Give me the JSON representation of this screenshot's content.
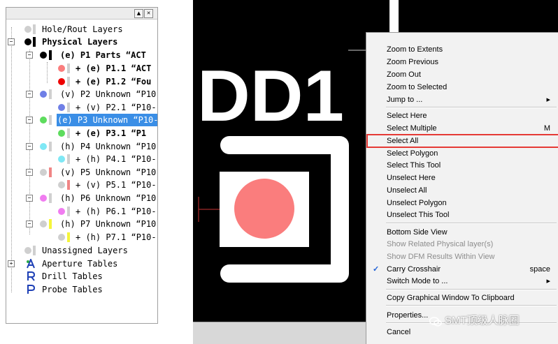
{
  "tree": {
    "items": [
      {
        "label": "Hole/Rout Layers"
      },
      {
        "label": "Physical Layers"
      },
      {
        "label": "(e) P1 Parts “ACT"
      },
      {
        "label": "+ (e) P1.1 “ACT"
      },
      {
        "label": "+ (e) P1.2 “Fou"
      },
      {
        "label": "(v) P2 Unknown “P10-"
      },
      {
        "label": "+ (v) P2.1 “P10-"
      },
      {
        "label": "(e) P3 Unknown “P10-"
      },
      {
        "label": "+ (e) P3.1 “P1"
      },
      {
        "label": "(h) P4 Unknown “P10-"
      },
      {
        "label": "+ (h) P4.1 “P10-"
      },
      {
        "label": "(v) P5 Unknown “P10-"
      },
      {
        "label": "+ (v) P5.1 “P10-"
      },
      {
        "label": "(h) P6 Unknown “P10-"
      },
      {
        "label": "+ (h) P6.1 “P10-"
      },
      {
        "label": "(h) P7 Unknown “P10-"
      },
      {
        "label": "+ (h) P7.1 “P10-"
      },
      {
        "label": "Unassigned Layers"
      },
      {
        "label": "Aperture Tables"
      },
      {
        "label": "Drill Tables"
      },
      {
        "label": "Probe Tables"
      }
    ]
  },
  "canvas": {
    "silkscreen_text": "DD1"
  },
  "menu": {
    "items": [
      {
        "label": "Zoom to Extents",
        "key": ""
      },
      {
        "label": "Zoom Previous",
        "key": ""
      },
      {
        "label": "Zoom Out",
        "key": ""
      },
      {
        "label": "Zoom to Selected",
        "key": ""
      },
      {
        "label": "Jump to ...",
        "key": "▸"
      },
      {
        "label": "Select Here",
        "key": ""
      },
      {
        "label": "Select Multiple",
        "key": "M"
      },
      {
        "label": "Select All",
        "key": ""
      },
      {
        "label": "Select Polygon",
        "key": ""
      },
      {
        "label": "Select This Tool",
        "key": ""
      },
      {
        "label": "Unselect Here",
        "key": ""
      },
      {
        "label": "Unselect All",
        "key": ""
      },
      {
        "label": "Unselect Polygon",
        "key": ""
      },
      {
        "label": "Unselect This Tool",
        "key": ""
      },
      {
        "label": "Bottom Side View",
        "key": ""
      },
      {
        "label": "Show Related Physical layer(s)",
        "key": ""
      },
      {
        "label": "Show DFM Results Within View",
        "key": ""
      },
      {
        "label": "Carry Crosshair",
        "key": "space",
        "check": "✓"
      },
      {
        "label": "Switch Mode to ...",
        "key": "▸"
      },
      {
        "label": "Copy Graphical Window To Clipboard",
        "key": ""
      },
      {
        "label": "Properties...",
        "key": ""
      },
      {
        "label": "Cancel",
        "key": ""
      }
    ]
  },
  "watermark": "SMT顶级人脉圈",
  "colors": {
    "selection": "#3a8ee6",
    "highlight_box": "#e53935",
    "pad": "#fa7d7d"
  }
}
